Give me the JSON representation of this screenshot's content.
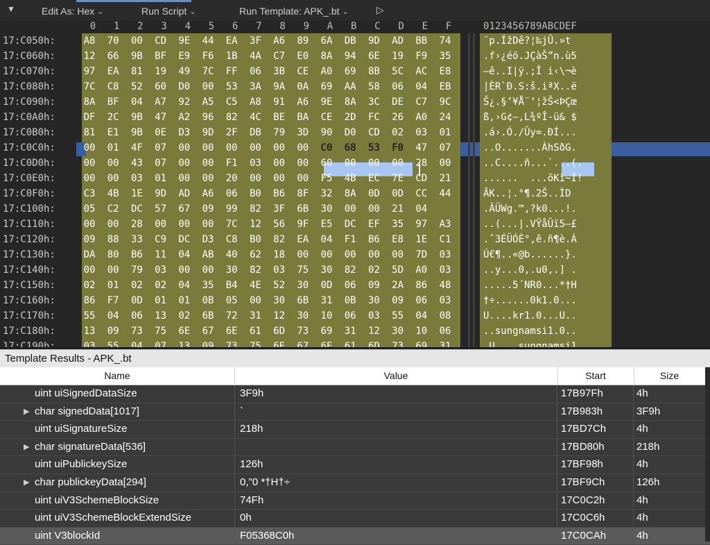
{
  "toolbar": {
    "collapse_icon": "double-chevron-down-icon",
    "edit_as": "Edit As: Hex",
    "run_script": "Run Script",
    "run_template": "Run Template: APK_.bt",
    "play_icon": "play-icon"
  },
  "hex": {
    "columns": [
      "0",
      "1",
      "2",
      "3",
      "4",
      "5",
      "6",
      "7",
      "8",
      "9",
      "A",
      "B",
      "C",
      "D",
      "E",
      "F"
    ],
    "ascii_header": "0123456789ABCDEF",
    "rows": [
      {
        "addr": "17:C050h:",
        "bytes": [
          "A8",
          "70",
          "00",
          "CD",
          "9E",
          "44",
          "EA",
          "3F",
          "A6",
          "89",
          "6A",
          "DB",
          "9D",
          "AD",
          "BB",
          "74"
        ],
        "ascii": "¨p.ÍžDê?¦‰jÛ.­»t"
      },
      {
        "addr": "17:C060h:",
        "bytes": [
          "12",
          "66",
          "9B",
          "BF",
          "E9",
          "F6",
          "1B",
          "4A",
          "C7",
          "E0",
          "8A",
          "94",
          "6E",
          "19",
          "F9",
          "35"
        ],
        "ascii": ".f›¿éö.JÇàŠ”n.ù5"
      },
      {
        "addr": "17:C070h:",
        "bytes": [
          "97",
          "EA",
          "81",
          "19",
          "49",
          "7C",
          "FF",
          "06",
          "3B",
          "CE",
          "A0",
          "69",
          "8B",
          "5C",
          "AC",
          "E8"
        ],
        "ascii": "—ê..I|ÿ.;Î i‹\\¬è"
      },
      {
        "addr": "17:C080h:",
        "bytes": [
          "7C",
          "C8",
          "52",
          "60",
          "D0",
          "00",
          "53",
          "3A",
          "9A",
          "0A",
          "69",
          "AA",
          "58",
          "06",
          "04",
          "EB"
        ],
        "ascii": "|ÈR`Ð.S:š.iªX..ë"
      },
      {
        "addr": "17:C090h:",
        "bytes": [
          "8A",
          "BF",
          "04",
          "A7",
          "92",
          "A5",
          "C5",
          "A8",
          "91",
          "A6",
          "9E",
          "8A",
          "3C",
          "DE",
          "C7",
          "9C"
        ],
        "ascii": "Š¿.§’¥Å¨‘¦žŠ<ÞÇœ"
      },
      {
        "addr": "17:C0A0h:",
        "bytes": [
          "DF",
          "2C",
          "9B",
          "47",
          "A2",
          "96",
          "82",
          "4C",
          "BE",
          "BA",
          "CE",
          "2D",
          "FC",
          "26",
          "A0",
          "24"
        ],
        "ascii": "ß,›G¢–‚L¾ºÎ-ü& $"
      },
      {
        "addr": "17:C0B0h:",
        "bytes": [
          "81",
          "E1",
          "9B",
          "0E",
          "D3",
          "9D",
          "2F",
          "DB",
          "79",
          "3D",
          "90",
          "D0",
          "CD",
          "02",
          "03",
          "01"
        ],
        "ascii": ".á›.Ó./Ûy=.ÐÍ..."
      },
      {
        "addr": "17:C0C0h:",
        "bytes": [
          "00",
          "01",
          "4F",
          "07",
          "00",
          "00",
          "00",
          "00",
          "00",
          "00",
          "C0",
          "68",
          "53",
          "F0",
          "47",
          "07"
        ],
        "ascii": "..O.......ÀhSðG."
      },
      {
        "addr": "17:C0D0h:",
        "bytes": [
          "00",
          "00",
          "43",
          "07",
          "00",
          "00",
          "F1",
          "03",
          "00",
          "00",
          "60",
          "00",
          "00",
          "00",
          "28",
          "00"
        ],
        "ascii": "..C....ñ...`...(."
      },
      {
        "addr": "17:C0E0h:",
        "bytes": [
          "00",
          "00",
          "03",
          "01",
          "00",
          "00",
          "20",
          "00",
          "00",
          "00",
          "F5",
          "4B",
          "EC",
          "7E",
          "CD",
          "21"
        ],
        "ascii": "......  ...õKì~Í!"
      },
      {
        "addr": "17:C0F0h:",
        "bytes": [
          "C3",
          "4B",
          "1E",
          "9D",
          "AD",
          "A6",
          "06",
          "B0",
          "B6",
          "8F",
          "32",
          "8A",
          "0D",
          "0D",
          "CC",
          "44"
        ],
        "ascii": "ÃK..­¦.°¶.2Š..ÌD"
      },
      {
        "addr": "17:C100h:",
        "bytes": [
          "05",
          "C2",
          "DC",
          "57",
          "67",
          "09",
          "99",
          "82",
          "3F",
          "6B",
          "30",
          "00",
          "00",
          "21",
          "04"
        ],
        "ascii": ".ÂÜWg.™‚?k0...!."
      },
      {
        "addr": "17:C110h:",
        "bytes": [
          "00",
          "00",
          "28",
          "00",
          "00",
          "00",
          "7C",
          "12",
          "56",
          "9F",
          "E5",
          "DC",
          "EF",
          "35",
          "97",
          "A3"
        ],
        "ascii": "..(...|.VŸåÜï5—£"
      },
      {
        "addr": "17:C120h:",
        "bytes": [
          "09",
          "88",
          "33",
          "C9",
          "DC",
          "D3",
          "C8",
          "B0",
          "82",
          "EA",
          "04",
          "F1",
          "B6",
          "E8",
          "1E",
          "C1"
        ],
        "ascii": ".ˆ3ÉÜÓÈ°‚ê.ñ¶è.Á"
      },
      {
        "addr": "17:C130h:",
        "bytes": [
          "DA",
          "80",
          "B6",
          "11",
          "04",
          "AB",
          "40",
          "62",
          "18",
          "00",
          "00",
          "00",
          "00",
          "00",
          "7D",
          "03"
        ],
        "ascii": "Ú€¶..«@b......}."
      },
      {
        "addr": "17:C140h:",
        "bytes": [
          "00",
          "00",
          "79",
          "03",
          "00",
          "00",
          "30",
          "82",
          "03",
          "75",
          "30",
          "82",
          "02",
          "5D",
          "A0",
          "03"
        ],
        "ascii": "..y...0‚.u0‚.] ."
      },
      {
        "addr": "17:C150h:",
        "bytes": [
          "02",
          "01",
          "02",
          "02",
          "04",
          "35",
          "B4",
          "4E",
          "52",
          "30",
          "0D",
          "06",
          "09",
          "2A",
          "86",
          "48"
        ],
        "ascii": ".....5´NR0...*†H"
      },
      {
        "addr": "17:C160h:",
        "bytes": [
          "86",
          "F7",
          "0D",
          "01",
          "01",
          "0B",
          "05",
          "00",
          "30",
          "6B",
          "31",
          "0B",
          "30",
          "09",
          "06",
          "03"
        ],
        "ascii": "†÷......0k1.0..."
      },
      {
        "addr": "17:C170h:",
        "bytes": [
          "55",
          "04",
          "06",
          "13",
          "02",
          "6B",
          "72",
          "31",
          "12",
          "30",
          "10",
          "06",
          "03",
          "55",
          "04",
          "08"
        ],
        "ascii": "U....kr1.0...U.."
      },
      {
        "addr": "17:C180h:",
        "bytes": [
          "13",
          "09",
          "73",
          "75",
          "6E",
          "67",
          "6E",
          "61",
          "6D",
          "73",
          "69",
          "31",
          "12",
          "30",
          "10",
          "06"
        ],
        "ascii": "..sungnamsi1.0.."
      },
      {
        "addr": "17:C190h:",
        "bytes": [
          "03",
          "55",
          "04",
          "07",
          "13",
          "09",
          "73",
          "75",
          "6E",
          "67",
          "6E",
          "61",
          "6D",
          "73",
          "69",
          "31"
        ],
        "ascii": ".U....sungnamsi1"
      }
    ]
  },
  "template_results": {
    "title": "Template Results - APK_.bt",
    "headers": {
      "name": "Name",
      "value": "Value",
      "start": "Start",
      "size": "Size"
    },
    "rows": [
      {
        "name": "uint uiSignedDataSize",
        "value": "3F9h",
        "start": "17B97Fh",
        "size": "4h",
        "expandable": false
      },
      {
        "name": "char signedData[1017]",
        "value": "`",
        "start": "17B983h",
        "size": "3F9h",
        "expandable": true
      },
      {
        "name": "uint uiSignatureSize",
        "value": "218h",
        "start": "17BD7Ch",
        "size": "4h",
        "expandable": false
      },
      {
        "name": "char signatureData[536]",
        "value": "",
        "start": "17BD80h",
        "size": "218h",
        "expandable": true
      },
      {
        "name": "uint uiPublickeySize",
        "value": "126h",
        "start": "17BF98h",
        "size": "4h",
        "expandable": false
      },
      {
        "name": "char publickeyData[294]",
        "value": "0,\"0  *†H†÷",
        "start": "17BF9Ch",
        "size": "126h",
        "expandable": true
      },
      {
        "name": "uint uiV3SchemeBlockSize",
        "value": "74Fh",
        "start": "17C0C2h",
        "size": "4h",
        "expandable": false
      },
      {
        "name": "uint uiV3SchemeBlockExtendSize",
        "value": "0h",
        "start": "17C0C6h",
        "size": "4h",
        "expandable": false
      },
      {
        "name": "uint V3blockId",
        "value": "F05368C0h",
        "start": "17C0CAh",
        "size": "4h",
        "expandable": false,
        "selected": true
      }
    ]
  }
}
